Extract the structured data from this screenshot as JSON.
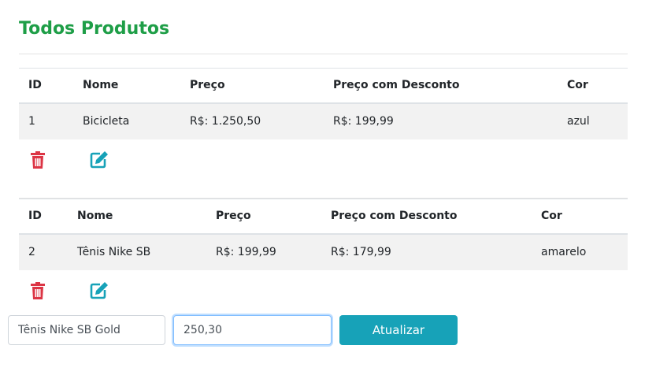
{
  "page": {
    "title": "Todos Produtos"
  },
  "headers": {
    "id": "ID",
    "name": "Nome",
    "price": "Preço",
    "discount": "Preço com Desconto",
    "color": "Cor"
  },
  "products": [
    {
      "id": "1",
      "name": "Bicicleta",
      "price": "R$: 1.250,50",
      "discount": "R$: 199,99",
      "color": "azul"
    },
    {
      "id": "2",
      "name": "Tênis Nike SB",
      "price": "R$: 199,99",
      "discount": "R$: 179,99",
      "color": "amarelo"
    }
  ],
  "icons": {
    "delete": "trash-icon",
    "edit": "edit-icon"
  },
  "colors": {
    "title": "#1e9e47",
    "delete": "#dc3545",
    "edit": "#17a2b8",
    "button": "#17a2b8"
  },
  "form": {
    "name_value": "Tênis Nike SB Gold",
    "price_value": "250,30",
    "submit_label": "Atualizar"
  }
}
